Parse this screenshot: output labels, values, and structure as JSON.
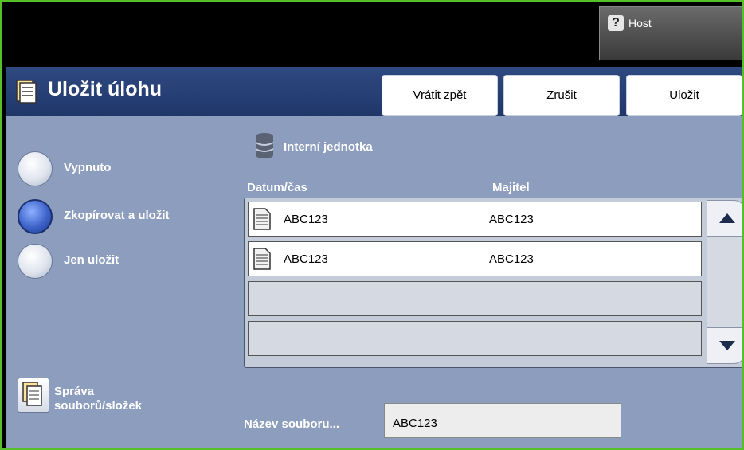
{
  "header": {
    "help_icon": "question-mark-icon",
    "user_label": "Host"
  },
  "title_bar": {
    "title": "Uložit úlohu",
    "icon": "folder-icon",
    "buttons": {
      "undo": "Vrátit zpět",
      "cancel": "Zrušit",
      "save": "Uložit"
    }
  },
  "options": {
    "items": [
      {
        "label": "Vypnuto",
        "selected": false
      },
      {
        "label": "Zkopírovat a uložit",
        "selected": true
      },
      {
        "label": "Jen uložit",
        "selected": false
      }
    ]
  },
  "file_manager": {
    "label_line1": "Správa",
    "label_line2": "souborů/složek",
    "icon": "folder-icon"
  },
  "storage": {
    "drive_label": "Interní jednotka",
    "drive_icon": "database-icon",
    "columns": {
      "datetime": "Datum/čas",
      "owner": "Majitel"
    },
    "rows": [
      {
        "datetime": "ABC123",
        "owner": "ABC123",
        "icon": "document-icon"
      },
      {
        "datetime": "ABC123",
        "owner": "ABC123",
        "icon": "document-icon"
      },
      {
        "datetime": "",
        "owner": ""
      },
      {
        "datetime": "",
        "owner": ""
      }
    ],
    "scroll": {
      "up_icon": "arrow-up-icon",
      "down_icon": "arrow-down-icon"
    }
  },
  "filename": {
    "label": "Název souboru...",
    "value": "ABC123"
  },
  "colors": {
    "accent_green": "#56c02a",
    "title_bar": "#2f4a82",
    "panel": "#8c9dbe"
  }
}
